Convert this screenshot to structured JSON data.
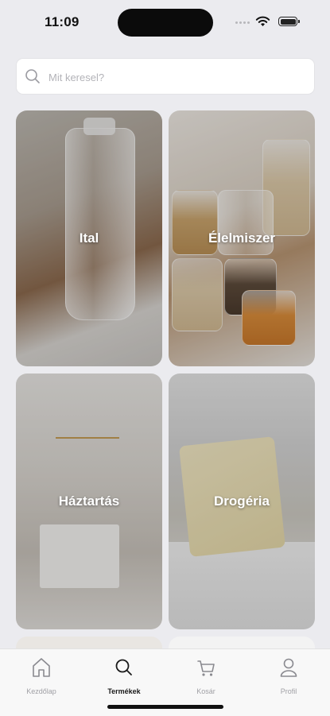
{
  "status_bar": {
    "time": "11:09"
  },
  "search": {
    "placeholder": "Mit keresel?",
    "value": ""
  },
  "categories": [
    {
      "label": "Ital"
    },
    {
      "label": "Élelmiszer"
    },
    {
      "label": "Háztartás"
    },
    {
      "label": "Drogéria"
    }
  ],
  "tab_bar": {
    "items": [
      {
        "label": "Kezdőlap",
        "icon": "home-icon"
      },
      {
        "label": "Termékek",
        "icon": "search-icon"
      },
      {
        "label": "Kosár",
        "icon": "cart-icon"
      },
      {
        "label": "Profil",
        "icon": "profile-icon"
      }
    ],
    "active": "Termékek"
  }
}
